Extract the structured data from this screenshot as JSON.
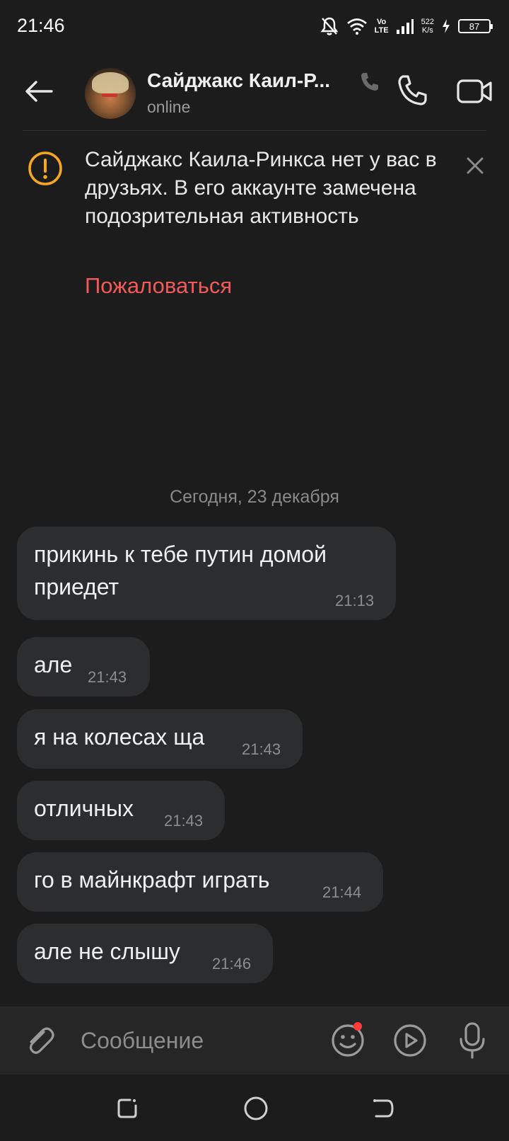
{
  "status_bar": {
    "time": "21:46",
    "lte_top": "Vo",
    "lte_bottom": "LTE",
    "net_speed_value": "522",
    "net_speed_unit": "K/s",
    "battery": "87"
  },
  "header": {
    "contact_name": "Сайджакс Каил-Р...",
    "status": "online"
  },
  "warning": {
    "text": "Сайджакс Каила-Ринкса нет у вас в друзьях. В его аккаунте замечена подозрительная активность",
    "report_label": "Пожаловаться",
    "report_color": "#f25a5a",
    "icon_color": "#f5a623"
  },
  "chat": {
    "date": "Сегодня, 23 декабря",
    "messages": [
      {
        "text_line1": "прикинь к тебе путин домой",
        "text_line2": "приедет",
        "time": "21:13"
      },
      {
        "text": "але",
        "time": "21:43"
      },
      {
        "text": "я на колесах ща",
        "time": "21:43"
      },
      {
        "text": "отличных",
        "time": "21:43"
      },
      {
        "text": "го в майнкрафт играть",
        "time": "21:44"
      },
      {
        "text": "але не слышу",
        "time": "21:46"
      }
    ]
  },
  "input": {
    "placeholder": "Сообщение"
  },
  "icons": {
    "back": "arrow-left-icon",
    "call": "phone-icon",
    "video": "video-camera-icon",
    "warning": "exclamation-circle-icon",
    "close": "close-icon",
    "attach": "paperclip-icon",
    "emoji": "smiley-icon",
    "video_message": "play-circle-icon",
    "mic": "microphone-icon"
  }
}
